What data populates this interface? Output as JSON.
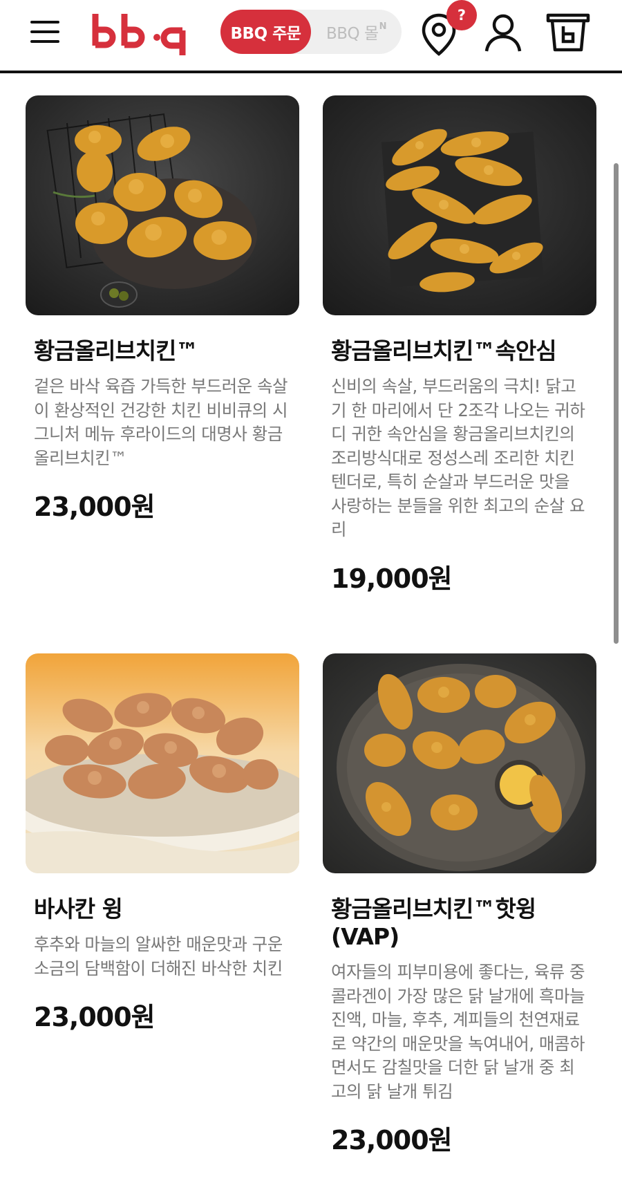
{
  "header": {
    "logo_text": "bb·q",
    "mode_active_label": "BBQ 주문",
    "mode_inactive_label": "BBQ 몰",
    "mode_inactive_badge": "N",
    "location_badge": "?",
    "brand_color": "#d6303c",
    "icons": [
      "menu-icon",
      "location-pin-icon",
      "user-icon",
      "cart-bucket-icon"
    ]
  },
  "products": [
    {
      "name": "황금올리브치킨™",
      "description": "겉은 바삭 육즙 가득한 부드러운 속살이 환상적인 건강한 치킨 비비큐의 시그니처 메뉴 후라이드의 대명사 황금올리브치킨™",
      "price": "23,000원"
    },
    {
      "name": "황금올리브치킨™속안심",
      "description": "신비의 속살, 부드러움의 극치! 닭고기 한 마리에서 단 2조각 나오는 귀하디 귀한 속안심을 황금올리브치킨의 조리방식대로 정성스레 조리한 치킨텐더로, 특히 순살과 부드러운 맛을 사랑하는 분들을 위한 최고의 순살 요리",
      "price": "19,000원"
    },
    {
      "name": "바사칸 윙",
      "description": "후추와 마늘의 알싸한 매운맛과 구운 소금의 담백함이 더해진 바삭한 치킨",
      "price": "23,000원"
    },
    {
      "name": "황금올리브치킨™핫윙(VAP)",
      "description": "여자들의 피부미용에 좋다는, 육류 중 콜라겐이 가장 많은 닭 날개에 흑마늘 진액, 마늘, 후추, 계피들의 천연재료로 약간의 매운맛을 녹여내어, 매콤하면서도 감칠맛을 더한 닭 날개 중 최고의 닭 날개 튀김",
      "price": "23,000원"
    }
  ]
}
